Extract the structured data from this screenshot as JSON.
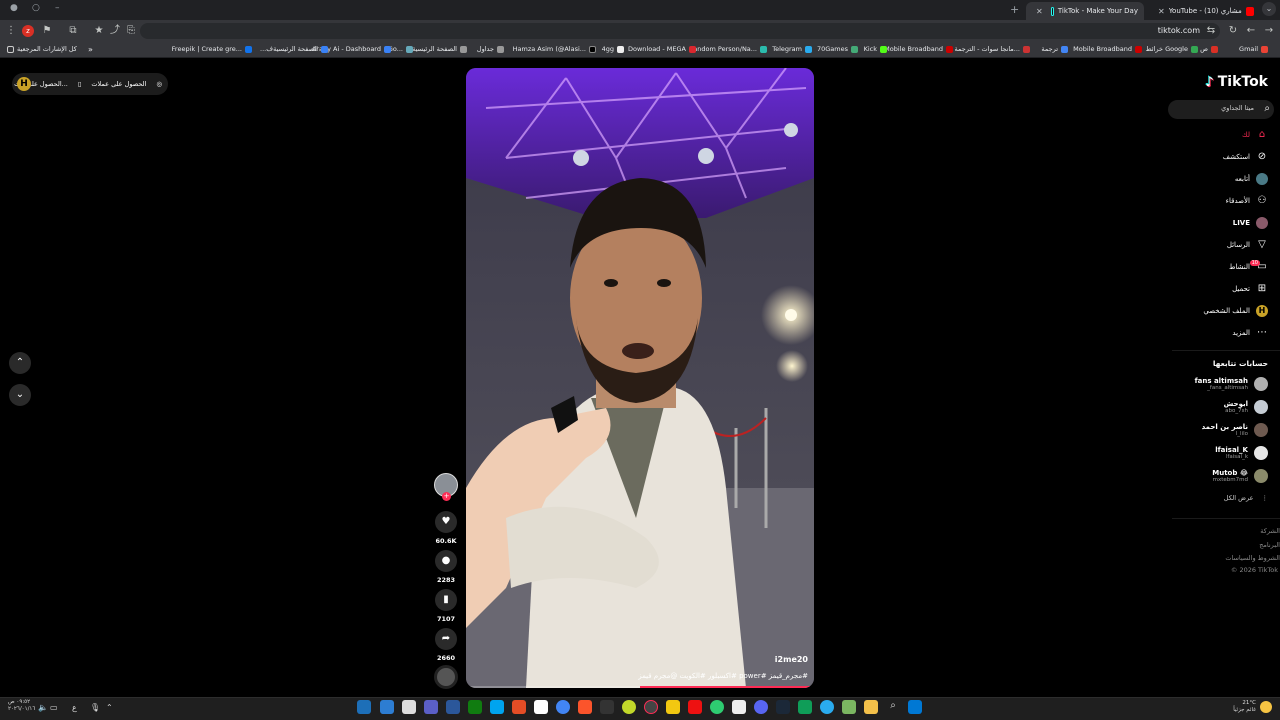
{
  "browser": {
    "tabs": [
      {
        "title": "YouTube - (10) رده فعل مشاري",
        "active": false
      },
      {
        "title": "TikTok - Make Your Day",
        "active": true
      }
    ],
    "url": "tiktok.com",
    "bookmarks": [
      "Gmail",
      "ص",
      "خرائط Google",
      "Mobile Broadband",
      "ترجمة",
      "مانجا سوات - الترجمة...",
      "Mobile Broadband",
      "Kick",
      "70Games",
      "Telegram",
      "Random Person/Na...",
      "Download - MEGA",
      "4gg",
      "Hamza Asim (@Alasi...",
      "جداول",
      "الصفحة الرئيسية",
      "Go...",
      "Araby Ai - Dashboard",
      "الصفحة الرئيسية",
      "...ف",
      "Freepik | Create gre...",
      "كل الإشارات المرجعية"
    ]
  },
  "page": {
    "coins_chip": {
      "item1": "الحصول على عملات",
      "item2": "الحصول على الت..."
    },
    "video": {
      "username": "i2me20",
      "caption": "#مجرم_قيمز #power #اكسبلور #الكويت @مجرم قيمز",
      "progress": 0.5
    },
    "actions": {
      "likes": "60.6K",
      "comments": "2283",
      "saves": "7107",
      "shares": "2660"
    },
    "sidebar": {
      "logo": "TikTok",
      "search_text": "ميثا الجداوي",
      "nav": [
        {
          "label": "لك",
          "icon": "home-icon",
          "active": true
        },
        {
          "label": "استكشف",
          "icon": "compass-icon"
        },
        {
          "label": "أتابعه",
          "icon": "avatar-icon"
        },
        {
          "label": "الأصدقاء",
          "icon": "friends-icon"
        },
        {
          "label": "LIVE",
          "icon": "live-icon"
        },
        {
          "label": "الرسائل",
          "icon": "send-icon"
        },
        {
          "label": "النشاط",
          "icon": "inbox-icon"
        },
        {
          "label": "تحميل",
          "icon": "upload-icon"
        },
        {
          "label": "الملف الشخصي",
          "icon": "profile-icon"
        },
        {
          "label": "المزيد",
          "icon": "more-icon"
        }
      ],
      "activity_badge": "10",
      "following_title": "حسابات تتابعها",
      "following": [
        {
          "name": "fans altimsah",
          "handle": "_fans_altimsah"
        },
        {
          "name": "ابوحش",
          "handle": "abo_7sh"
        },
        {
          "name": "ناصر بن احمد",
          "handle": "l_lilo"
        },
        {
          "name": "lfaisal_K",
          "handle": "lfaisal_k"
        },
        {
          "name": "Mutob 😂",
          "handle": "mxtebm7md"
        }
      ],
      "see_all": "عرض الكل",
      "footer": [
        "الشركة",
        "البرنامج",
        "الشروط والسياسات"
      ],
      "copyright": "© 2026 TikTok"
    }
  },
  "taskbar": {
    "time": "٠٩:٥٢ ص",
    "date": "٢٠٢٦/٠١/١٦",
    "lang": "ع",
    "weather_temp": "21°C",
    "weather_desc": "غائم جزئياً"
  },
  "colors": {
    "accent": "#fe2c55",
    "tab_active": "#35363a",
    "chrome": "#202124"
  }
}
